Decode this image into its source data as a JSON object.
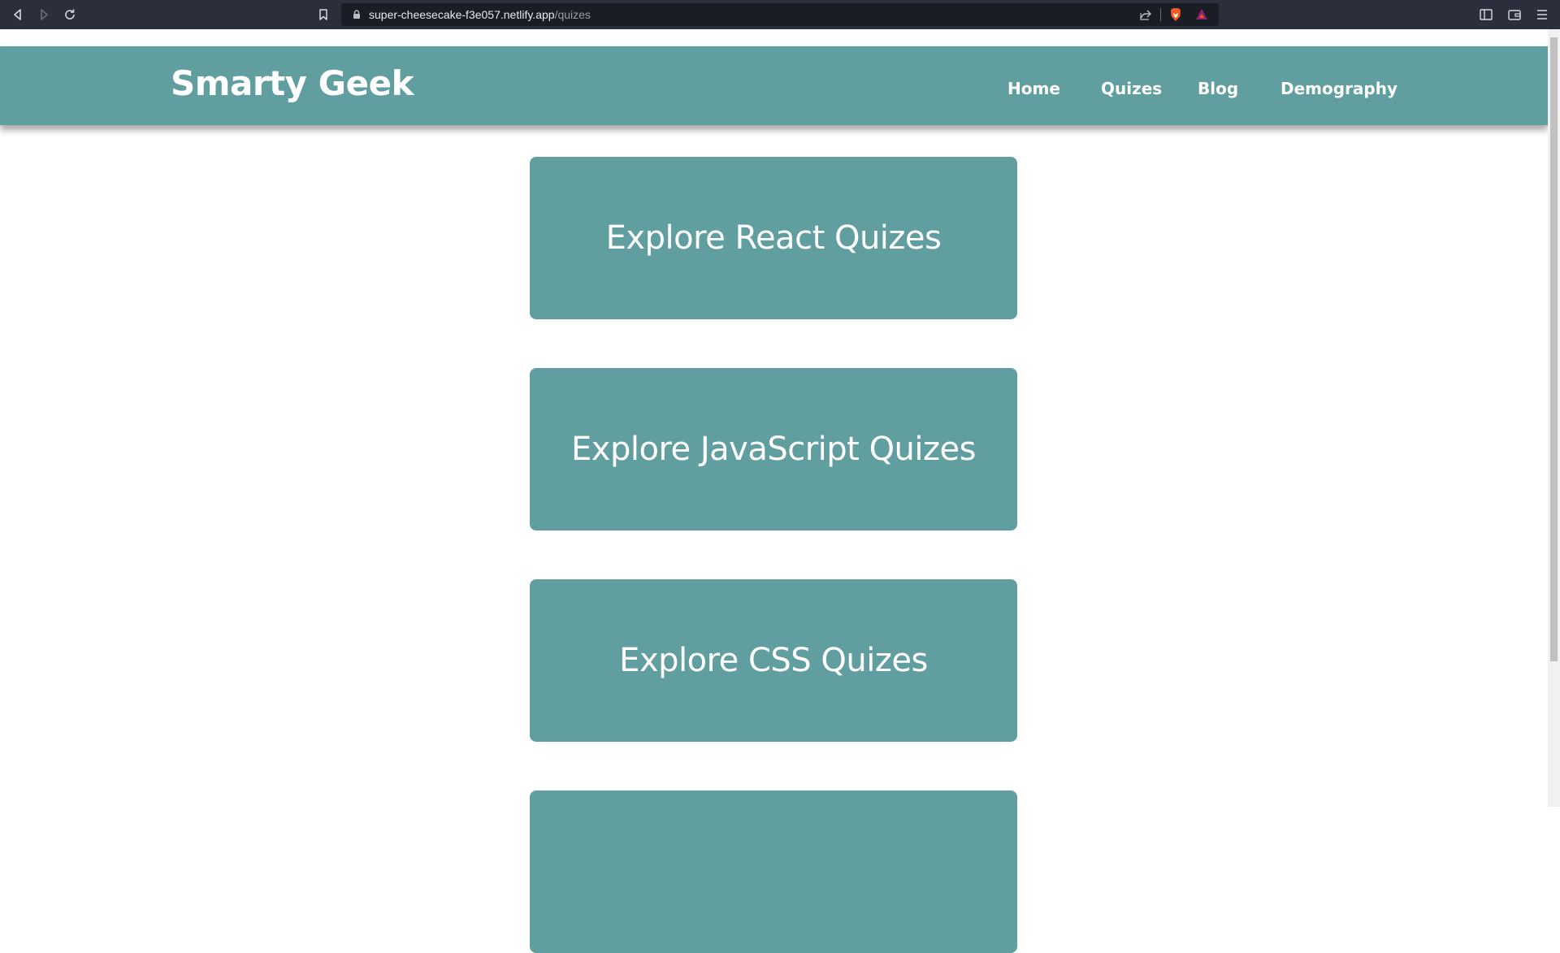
{
  "browser": {
    "url_host": "super-cheesecake-f3e057.netlify.app",
    "url_path": "/quizes",
    "icons": [
      "back-icon",
      "forward-icon",
      "reload-icon",
      "bookmark-icon",
      "lock-icon",
      "share-icon",
      "brave-shields-icon",
      "brave-rewards-icon",
      "sidebar-icon",
      "wallet-icon",
      "menu-icon"
    ]
  },
  "header": {
    "title": "Smarty Geek",
    "nav": [
      {
        "label": "Home"
      },
      {
        "label": "Quizes"
      },
      {
        "label": "Blog"
      },
      {
        "label": "Demography"
      }
    ]
  },
  "cards": [
    {
      "label": "Explore React Quizes"
    },
    {
      "label": "Explore JavaScript Quizes"
    },
    {
      "label": "Explore CSS Quizes"
    },
    {
      "label": ""
    }
  ],
  "colors": {
    "brand": "#619e9f",
    "chrome": "#2b2e3b",
    "address_bar": "#1b1d26"
  }
}
